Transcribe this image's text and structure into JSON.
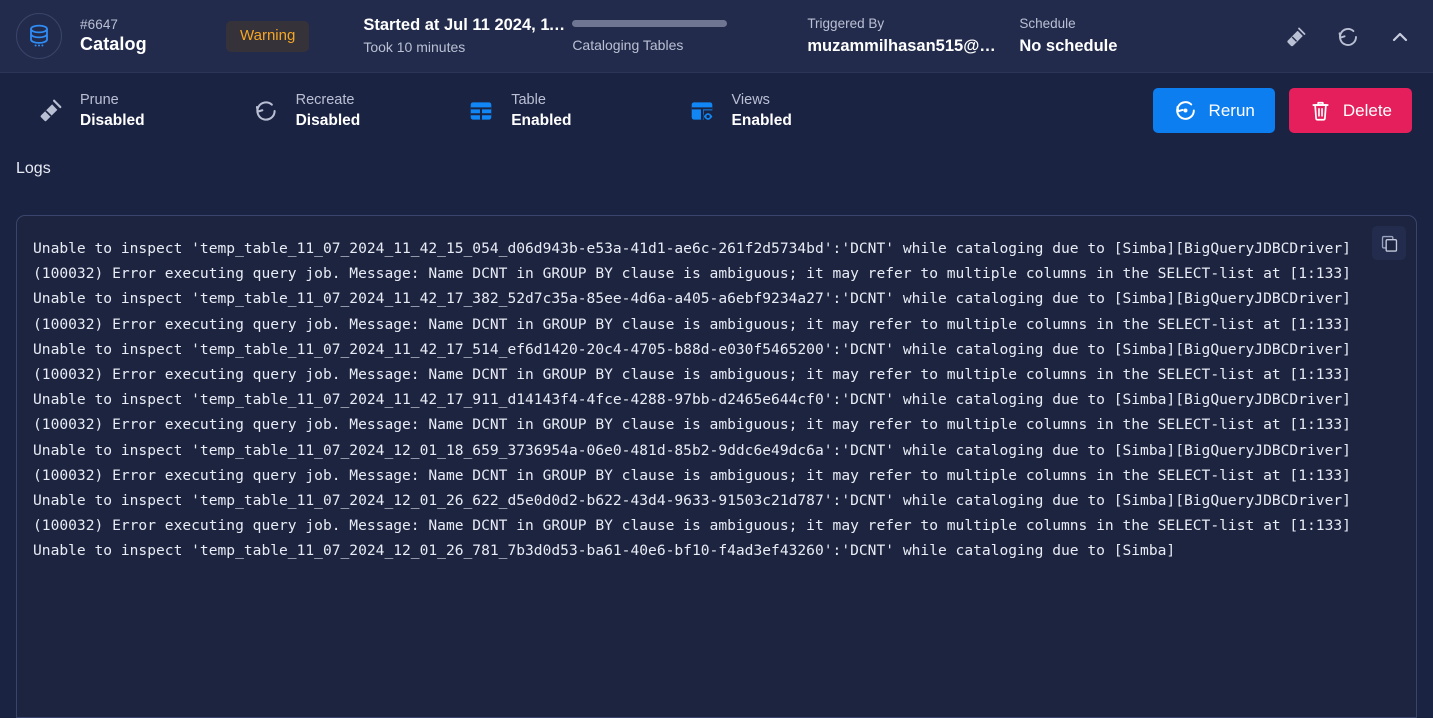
{
  "header": {
    "db_icon": "database-icon",
    "run_id": "#6647",
    "job_name": "Catalog",
    "status": "Warning",
    "started_at": "Started at Jul 11 2024, 11…",
    "duration": "Took 10 minutes",
    "progress_label": "Cataloging Tables",
    "progress_percent": 100,
    "triggered_by_label": "Triggered By",
    "triggered_by_value": "muzammilhasan515@…",
    "schedule_label": "Schedule",
    "schedule_value": "No schedule",
    "actions": [
      {
        "name": "prune-icon",
        "title": "Prune"
      },
      {
        "name": "recreate-icon",
        "title": "Recreate"
      },
      {
        "name": "collapse-icon",
        "title": "Collapse"
      }
    ]
  },
  "toolbar": {
    "items": [
      {
        "icon": "broom-icon",
        "label": "Prune",
        "value": "Disabled"
      },
      {
        "icon": "recreate-icon",
        "label": "Recreate",
        "value": "Disabled"
      },
      {
        "icon": "table-icon",
        "label": "Table",
        "value": "Enabled"
      },
      {
        "icon": "views-icon",
        "label": "Views",
        "value": "Enabled"
      }
    ],
    "rerun_label": "Rerun",
    "delete_label": "Delete"
  },
  "logs": {
    "section_title": "Logs",
    "copy_icon": "copy-icon",
    "text": "Unable to inspect 'temp_table_11_07_2024_11_42_15_054_d06d943b-e53a-41d1-ae6c-261f2d5734bd':'DCNT' while cataloging due to [Simba][BigQueryJDBCDriver](100032) Error executing query job. Message: Name DCNT in GROUP BY clause is ambiguous; it may refer to multiple columns in the SELECT-list at [1:133]\nUnable to inspect 'temp_table_11_07_2024_11_42_17_382_52d7c35a-85ee-4d6a-a405-a6ebf9234a27':'DCNT' while cataloging due to [Simba][BigQueryJDBCDriver](100032) Error executing query job. Message: Name DCNT in GROUP BY clause is ambiguous; it may refer to multiple columns in the SELECT-list at [1:133]\nUnable to inspect 'temp_table_11_07_2024_11_42_17_514_ef6d1420-20c4-4705-b88d-e030f5465200':'DCNT' while cataloging due to [Simba][BigQueryJDBCDriver](100032) Error executing query job. Message: Name DCNT in GROUP BY clause is ambiguous; it may refer to multiple columns in the SELECT-list at [1:133]\nUnable to inspect 'temp_table_11_07_2024_11_42_17_911_d14143f4-4fce-4288-97bb-d2465e644cf0':'DCNT' while cataloging due to [Simba][BigQueryJDBCDriver](100032) Error executing query job. Message: Name DCNT in GROUP BY clause is ambiguous; it may refer to multiple columns in the SELECT-list at [1:133]\nUnable to inspect 'temp_table_11_07_2024_12_01_18_659_3736954a-06e0-481d-85b2-9ddc6e49dc6a':'DCNT' while cataloging due to [Simba][BigQueryJDBCDriver](100032) Error executing query job. Message: Name DCNT in GROUP BY clause is ambiguous; it may refer to multiple columns in the SELECT-list at [1:133]\nUnable to inspect 'temp_table_11_07_2024_12_01_26_622_d5e0d0d2-b622-43d4-9633-91503c21d787':'DCNT' while cataloging due to [Simba][BigQueryJDBCDriver](100032) Error executing query job. Message: Name DCNT in GROUP BY clause is ambiguous; it may refer to multiple columns in the SELECT-list at [1:133]\nUnable to inspect 'temp_table_11_07_2024_12_01_26_781_7b3d0d53-ba61-40e6-bf10-f4ad3ef43260':'DCNT' while cataloging due to [Simba]"
  },
  "colors": {
    "page_bg": "#1b2342",
    "header_bg": "#222b4b",
    "accent_blue": "#0c7ef0",
    "danger_pink": "#e51f5c",
    "warning_orange": "#f5a623",
    "log_bg": "#1c2440"
  }
}
